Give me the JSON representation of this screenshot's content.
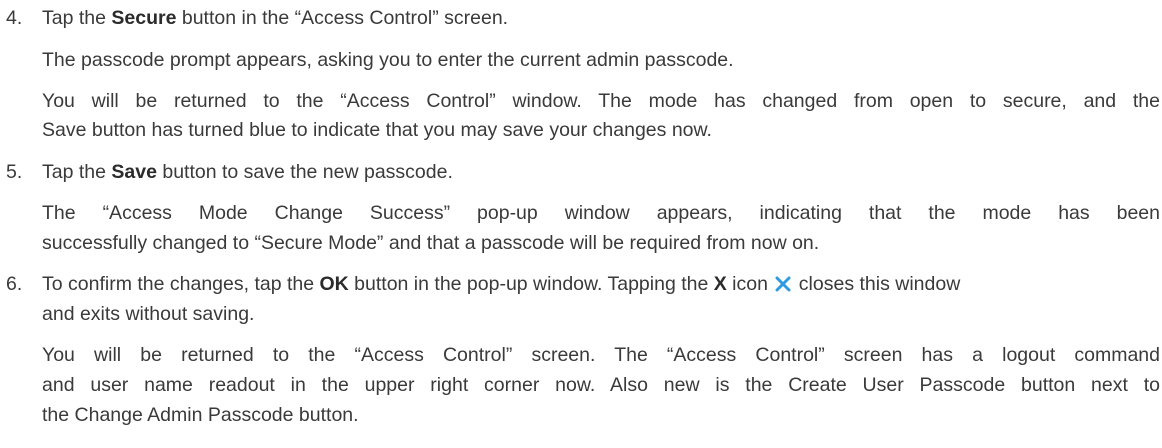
{
  "steps": [
    {
      "number": "4.",
      "instruction": {
        "pre": "Tap the ",
        "bold": "Secure",
        "post": " button in the “Access Control” screen."
      },
      "paragraphs": {
        "p1": "The passcode prompt appears, asking you to enter the current admin passcode.",
        "p2_line1": "You will be returned to the “Access Control” window. The mode has changed from open to secure, and the",
        "p2_line2": "Save button has turned blue to indicate that you may save your changes now."
      }
    },
    {
      "number": "5.",
      "instruction": {
        "pre": "Tap the ",
        "bold": "Save",
        "post": " button to save the new passcode."
      },
      "paragraphs": {
        "p1_line1": "The “Access Mode Change Success” pop-up window appears, indicating that the mode has been",
        "p1_line2": "successfully changed to “Secure Mode” and that a passcode will be required from now on."
      }
    },
    {
      "number": "6.",
      "instruction": {
        "pre": "To confirm the changes, tap the ",
        "bold": "OK",
        "mid": " button in the pop-up window. Tapping the ",
        "bold2": "X",
        "mid2": " icon ",
        "post": " closes this window",
        "line2": "and exits without saving."
      },
      "paragraphs": {
        "p1_line1": "You will be returned to the “Access Control” screen. The “Access Control” screen has a logout command",
        "p1_line2": "and user name readout in the upper right corner now. Also new is the Create User Passcode button next to",
        "p1_line3": "the Change Admin Passcode button."
      }
    }
  ],
  "icons": {
    "close": "close-icon",
    "close_color": "#2e9be0"
  }
}
